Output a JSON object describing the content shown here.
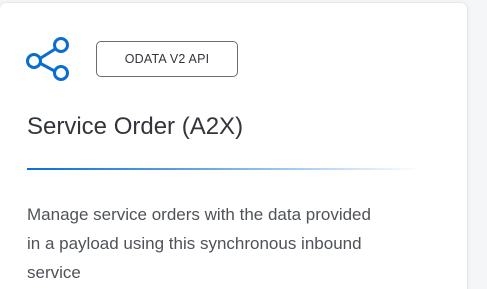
{
  "card": {
    "icon": "share-icon",
    "badge": "ODATA V2 API",
    "title": "Service Order (A2X)",
    "description": "Manage service orders with the data provided in a payload using this synchronous inbound service"
  },
  "colors": {
    "accent": "#0a6ed1",
    "text": "#32363a",
    "muted_text": "#4f5358",
    "badge_border": "#6a6d70",
    "card_bg": "#ffffff"
  }
}
